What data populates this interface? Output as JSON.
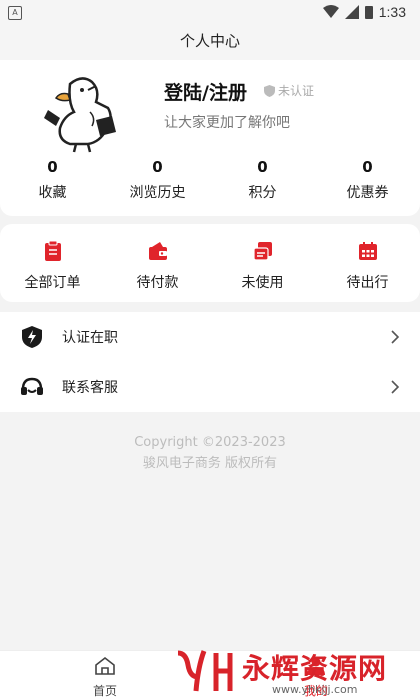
{
  "status_bar": {
    "time": "1:33"
  },
  "header": {
    "title": "个人中心"
  },
  "profile": {
    "login_label": "登陆/注册",
    "verify_badge": "未认证",
    "slogan": "让大家更加了解你吧"
  },
  "stats": [
    {
      "value": "0",
      "label": "收藏"
    },
    {
      "value": "0",
      "label": "浏览历史"
    },
    {
      "value": "0",
      "label": "积分"
    },
    {
      "value": "0",
      "label": "优惠券"
    }
  ],
  "orders": [
    {
      "label": "全部订单",
      "icon": "clipboard-icon"
    },
    {
      "label": "待付款",
      "icon": "wallet-icon"
    },
    {
      "label": "未使用",
      "icon": "ticket-icon"
    },
    {
      "label": "待出行",
      "icon": "calendar-icon"
    }
  ],
  "menu": [
    {
      "label": "认证在职",
      "icon": "shield-bolt-icon"
    },
    {
      "label": "联系客服",
      "icon": "headset-icon"
    }
  ],
  "footer": {
    "copyright": "Copyright ©2023-2023",
    "company": "骏风电子商务 版权所有"
  },
  "tabbar": {
    "home": "首页",
    "mine": "我的"
  },
  "watermark": {
    "text": "永辉资源网",
    "url": "www.yhkjjj.com"
  },
  "colors": {
    "accent": "#e0242b",
    "text": "#222222",
    "muted": "#777777"
  }
}
